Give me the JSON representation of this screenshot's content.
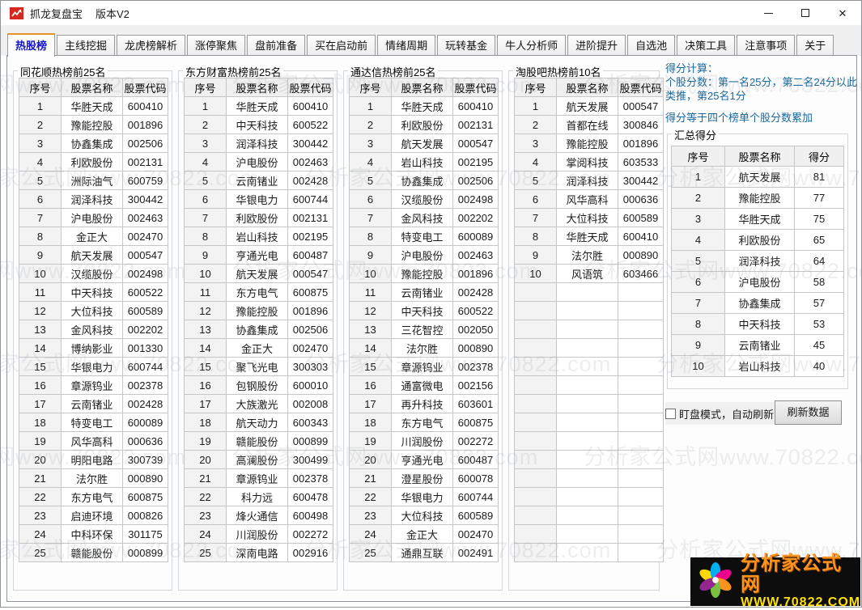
{
  "window": {
    "title": "抓龙复盘宝",
    "version": "版本V2"
  },
  "tabs": {
    "active_index": 0,
    "items": [
      "热股榜",
      "主线挖掘",
      "龙虎榜解析",
      "涨停聚焦",
      "盘前准备",
      "买在启动前",
      "情绪周期",
      "玩转基金",
      "牛人分析师",
      "进阶提升",
      "自选池",
      "决策工具",
      "注意事项",
      "关于"
    ]
  },
  "boards": [
    {
      "title": "同花顺热榜前25名",
      "columns": [
        "序号",
        "股票名称",
        "股票代码"
      ],
      "rows": [
        [
          "1",
          "华胜天成",
          "600410"
        ],
        [
          "2",
          "豫能控股",
          "001896"
        ],
        [
          "3",
          "协鑫集成",
          "002506"
        ],
        [
          "4",
          "利欧股份",
          "002131"
        ],
        [
          "5",
          "洲际油气",
          "600759"
        ],
        [
          "6",
          "润泽科技",
          "300442"
        ],
        [
          "7",
          "沪电股份",
          "002463"
        ],
        [
          "8",
          "金正大",
          "002470"
        ],
        [
          "9",
          "航天发展",
          "000547"
        ],
        [
          "10",
          "汉缆股份",
          "002498"
        ],
        [
          "11",
          "中天科技",
          "600522"
        ],
        [
          "12",
          "大位科技",
          "600589"
        ],
        [
          "13",
          "金风科技",
          "002202"
        ],
        [
          "14",
          "博纳影业",
          "001330"
        ],
        [
          "15",
          "华银电力",
          "600744"
        ],
        [
          "16",
          "章源钨业",
          "002378"
        ],
        [
          "17",
          "云南锗业",
          "002428"
        ],
        [
          "18",
          "特变电工",
          "600089"
        ],
        [
          "19",
          "风华高科",
          "000636"
        ],
        [
          "20",
          "明阳电路",
          "300739"
        ],
        [
          "21",
          "法尔胜",
          "000890"
        ],
        [
          "22",
          "东方电气",
          "600875"
        ],
        [
          "23",
          "启迪环境",
          "000826"
        ],
        [
          "24",
          "中科环保",
          "301175"
        ],
        [
          "25",
          "赣能股份",
          "000899"
        ]
      ]
    },
    {
      "title": "东方财富热榜前25名",
      "columns": [
        "序号",
        "股票名称",
        "股票代码"
      ],
      "rows": [
        [
          "1",
          "华胜天成",
          "600410"
        ],
        [
          "2",
          "中天科技",
          "600522"
        ],
        [
          "3",
          "润泽科技",
          "300442"
        ],
        [
          "4",
          "沪电股份",
          "002463"
        ],
        [
          "5",
          "云南锗业",
          "002428"
        ],
        [
          "6",
          "华银电力",
          "600744"
        ],
        [
          "7",
          "利欧股份",
          "002131"
        ],
        [
          "8",
          "岩山科技",
          "002195"
        ],
        [
          "9",
          "亨通光电",
          "600487"
        ],
        [
          "10",
          "航天发展",
          "000547"
        ],
        [
          "11",
          "东方电气",
          "600875"
        ],
        [
          "12",
          "豫能控股",
          "001896"
        ],
        [
          "13",
          "协鑫集成",
          "002506"
        ],
        [
          "14",
          "金正大",
          "002470"
        ],
        [
          "15",
          "聚飞光电",
          "300303"
        ],
        [
          "16",
          "包钢股份",
          "600010"
        ],
        [
          "17",
          "大族激光",
          "002008"
        ],
        [
          "18",
          "航天动力",
          "600343"
        ],
        [
          "19",
          "赣能股份",
          "000899"
        ],
        [
          "20",
          "高澜股份",
          "300499"
        ],
        [
          "21",
          "章源钨业",
          "002378"
        ],
        [
          "22",
          "科力远",
          "600478"
        ],
        [
          "23",
          "烽火通信",
          "600498"
        ],
        [
          "24",
          "川润股份",
          "002272"
        ],
        [
          "25",
          "深南电路",
          "002916"
        ]
      ]
    },
    {
      "title": "通达信热榜前25名",
      "columns": [
        "序号",
        "股票名称",
        "股票代码"
      ],
      "rows": [
        [
          "1",
          "华胜天成",
          "600410"
        ],
        [
          "2",
          "利欧股份",
          "002131"
        ],
        [
          "3",
          "航天发展",
          "000547"
        ],
        [
          "4",
          "岩山科技",
          "002195"
        ],
        [
          "5",
          "协鑫集成",
          "002506"
        ],
        [
          "6",
          "汉缆股份",
          "002498"
        ],
        [
          "7",
          "金风科技",
          "002202"
        ],
        [
          "8",
          "特变电工",
          "600089"
        ],
        [
          "9",
          "沪电股份",
          "002463"
        ],
        [
          "10",
          "豫能控股",
          "001896"
        ],
        [
          "11",
          "云南锗业",
          "002428"
        ],
        [
          "12",
          "中天科技",
          "600522"
        ],
        [
          "13",
          "三花智控",
          "002050"
        ],
        [
          "14",
          "法尔胜",
          "000890"
        ],
        [
          "15",
          "章源钨业",
          "002378"
        ],
        [
          "16",
          "通富微电",
          "002156"
        ],
        [
          "17",
          "再升科技",
          "603601"
        ],
        [
          "18",
          "东方电气",
          "600875"
        ],
        [
          "19",
          "川润股份",
          "002272"
        ],
        [
          "20",
          "亨通光电",
          "600487"
        ],
        [
          "21",
          "澄星股份",
          "600078"
        ],
        [
          "22",
          "华银电力",
          "600744"
        ],
        [
          "23",
          "大位科技",
          "600589"
        ],
        [
          "24",
          "金正大",
          "002470"
        ],
        [
          "25",
          "通鼎互联",
          "002491"
        ]
      ]
    },
    {
      "title": "淘股吧热榜前10名",
      "columns": [
        "序号",
        "股票名称",
        "股票代码"
      ],
      "rows": [
        [
          "1",
          "航天发展",
          "000547"
        ],
        [
          "2",
          "首都在线",
          "300846"
        ],
        [
          "3",
          "豫能控股",
          "001896"
        ],
        [
          "4",
          "掌阅科技",
          "603533"
        ],
        [
          "5",
          "润泽科技",
          "300442"
        ],
        [
          "6",
          "风华高科",
          "000636"
        ],
        [
          "7",
          "大位科技",
          "600589"
        ],
        [
          "8",
          "华胜天成",
          "600410"
        ],
        [
          "9",
          "法尔胜",
          "000890"
        ],
        [
          "10",
          "风语筑",
          "603466"
        ]
      ]
    }
  ],
  "score_panel": {
    "calc_title": "得分计算：",
    "calc_body": "个股分数：第一名25分，第二名24分以此类推，第25名1分",
    "calc_note": "得分等于四个榜单个股分数累加",
    "summary": {
      "title": "汇总得分",
      "columns": [
        "序号",
        "股票名称",
        "得分"
      ],
      "rows": [
        [
          "1",
          "航天发展",
          "81"
        ],
        [
          "2",
          "豫能控股",
          "77"
        ],
        [
          "3",
          "华胜天成",
          "75"
        ],
        [
          "4",
          "利欧股份",
          "65"
        ],
        [
          "5",
          "润泽科技",
          "64"
        ],
        [
          "6",
          "沪电股份",
          "58"
        ],
        [
          "7",
          "协鑫集成",
          "57"
        ],
        [
          "8",
          "中天科技",
          "53"
        ],
        [
          "9",
          "云南锗业",
          "45"
        ],
        [
          "10",
          "岩山科技",
          "40"
        ]
      ]
    },
    "checkbox_label": "盯盘模式，自动刷新",
    "checkbox_checked": false,
    "refresh_button": "刷新数据"
  },
  "watermark": {
    "tile_text": "分析家公式网www.70822.com",
    "brand": "分析家公式网",
    "url": "WWW.70822.COM"
  },
  "colors": {
    "tab_accent_orange": "#e8932c",
    "active_tab_text": "#1414c8",
    "info_text_blue": "#17689e",
    "app_icon_red": "#d5281e",
    "logo_brand_orange": "#ff9320",
    "logo_url_yellow": "#ffe000"
  }
}
